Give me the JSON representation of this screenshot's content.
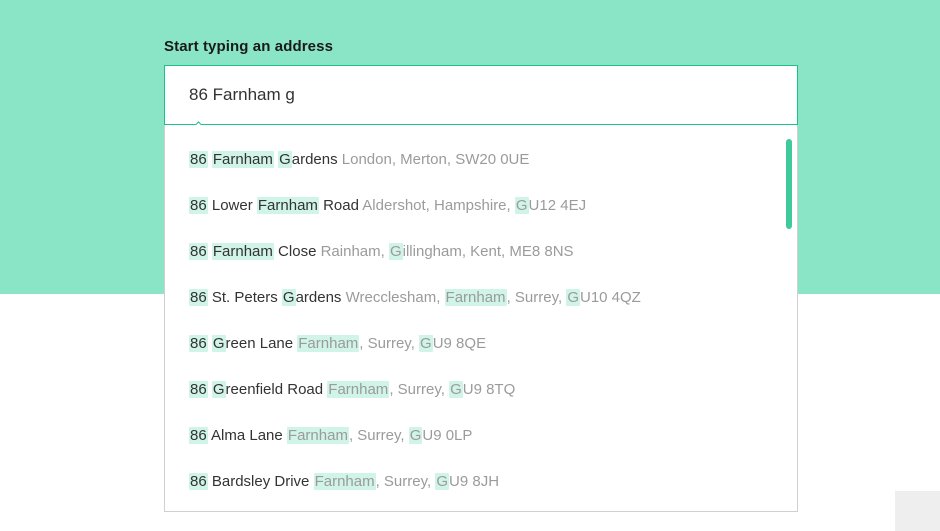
{
  "search": {
    "label": "Start typing an address",
    "value": "86 Farnham g"
  },
  "suggestions": [
    {
      "main": "86 Farnham Gardens",
      "secondary": "London, Merton, SW20 0UE"
    },
    {
      "main": "86 Lower Farnham Road",
      "secondary": "Aldershot, Hampshire, GU12 4EJ"
    },
    {
      "main": "86 Farnham Close",
      "secondary": "Rainham, Gillingham, Kent, ME8 8NS"
    },
    {
      "main": "86 St. Peters Gardens",
      "secondary": "Wrecclesham, Farnham, Surrey, GU10 4QZ"
    },
    {
      "main": "86 Green Lane",
      "secondary": "Farnham, Surrey, GU9 8QE"
    },
    {
      "main": "86 Greenfield Road",
      "secondary": "Farnham, Surrey, GU9 8TQ"
    },
    {
      "main": "86 Alma Lane",
      "secondary": "Farnham, Surrey, GU9 0LP"
    },
    {
      "main": "86 Bardsley Drive",
      "secondary": "Farnham, Surrey, GU9 8JH"
    }
  ],
  "highlight_tokens": [
    "86",
    "farnham",
    "g"
  ]
}
